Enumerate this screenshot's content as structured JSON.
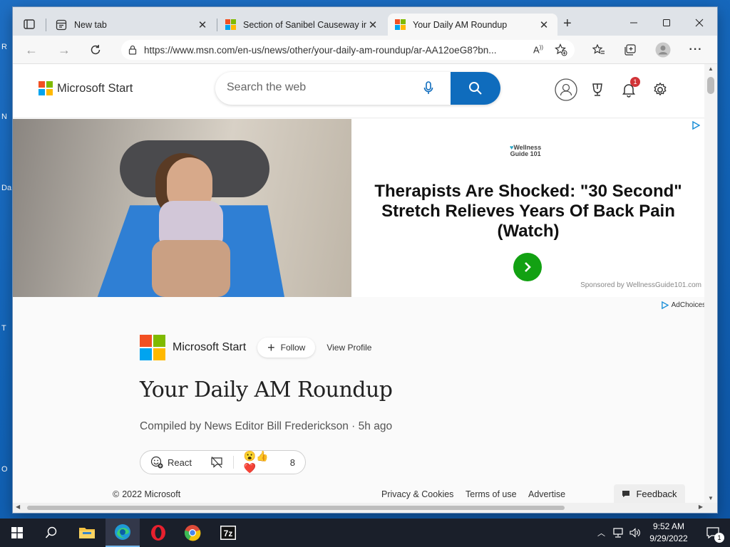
{
  "desktop": {
    "icon_labels": [
      "R",
      "N",
      "Da",
      "T",
      "O"
    ]
  },
  "browser": {
    "tabs": [
      {
        "label": "New tab",
        "icon": "new-tab-page-icon",
        "active": false
      },
      {
        "label": "Section of Sanibel Causeway in F",
        "icon": "msn-logo-icon",
        "active": false
      },
      {
        "label": "Your Daily AM Roundup",
        "icon": "msn-logo-icon",
        "active": true
      }
    ],
    "url": "https://www.msn.com/en-us/news/other/your-daily-am-roundup/ar-AA12oeG8?bn...",
    "read_aloud_label": "A̲"
  },
  "msn": {
    "brand": "Microsoft Start",
    "search_placeholder": "Search the web",
    "notification_count": "1",
    "logo_colors": [
      "#f25022",
      "#7fba00",
      "#00a4ef",
      "#ffb900"
    ]
  },
  "ad": {
    "brand_line1": "Wellness",
    "brand_line2": "Guide 101",
    "headline": "Therapists Are Shocked: \"30 Second\" Stretch Relieves Years Of Back Pain (Watch)",
    "sponsor": "Sponsored by WellnessGuide101.com",
    "adchoices": "AdChoices",
    "go_color": "#12a112"
  },
  "article": {
    "publisher": "Microsoft Start",
    "follow_label": "Follow",
    "view_profile_label": "View Profile",
    "title": "Your Daily AM Roundup",
    "byline": "Compiled by News Editor Bill Frederickson · 5h ago",
    "react_label": "React",
    "reaction_count": "8"
  },
  "footer": {
    "copyright": "2022 Microsoft",
    "privacy": "Privacy & Cookies",
    "terms": "Terms of use",
    "advertise": "Advertise",
    "feedback": "Feedback"
  },
  "taskbar": {
    "time": "9:52 AM",
    "date": "9/29/2022",
    "notification_count": "1"
  }
}
